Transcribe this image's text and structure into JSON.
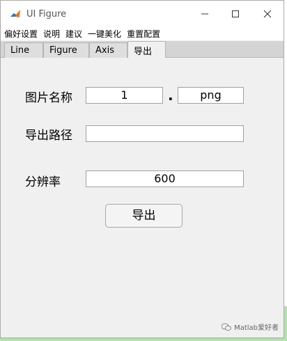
{
  "window": {
    "title": "UI Figure"
  },
  "menu": [
    "偏好设置",
    "说明",
    "建议",
    "一键美化",
    "重置配置"
  ],
  "tabs": [
    "Line",
    "Figure",
    "Axis",
    "导出"
  ],
  "active_tab": "导出",
  "export": {
    "name_label": "图片名称",
    "name_value": "1",
    "separator": ".",
    "ext_value": "png",
    "path_label": "导出路径",
    "path_value": "",
    "resolution_label": "分辨率",
    "resolution_value": "600",
    "export_button": "导出"
  },
  "watermark": "Matlab爱好者"
}
